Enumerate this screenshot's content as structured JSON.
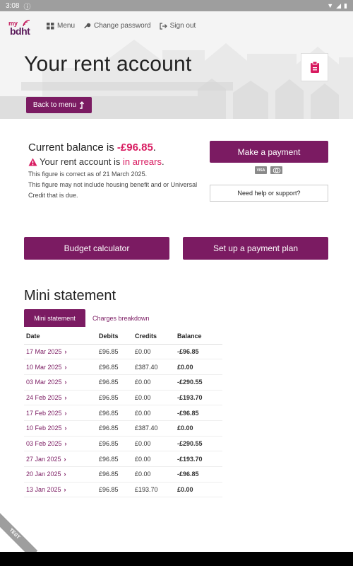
{
  "status_bar": {
    "time": "3:08",
    "info_icon": "info-icon",
    "wifi_icon": "wifi-icon",
    "signal_icon": "signal-icon",
    "battery_icon": "battery-icon"
  },
  "brand": {
    "logo_top": "my",
    "logo_main": "bdht",
    "accent": "#7b1b62",
    "highlight": "#d81b60"
  },
  "nav": {
    "menu": "Menu",
    "change_password": "Change password",
    "sign_out": "Sign out"
  },
  "header": {
    "title": "Your rent account",
    "back_label": "Back to menu"
  },
  "balance": {
    "prefix": "Current balance is ",
    "amount": "-£96.85",
    "suffix": ".",
    "arrears_prefix": "Your rent account is ",
    "arrears_word": "in arrears",
    "arrears_suffix": ".",
    "note_1": "This figure is correct as of 21 March 2025.",
    "note_2": "This figure may not include housing benefit and or Universal Credit that is due."
  },
  "actions": {
    "make_payment": "Make a payment",
    "card_visa": "VISA",
    "card_mc": "MC",
    "help": "Need help or support?",
    "budget": "Budget calculator",
    "payment_plan": "Set up a payment plan"
  },
  "mini_statement": {
    "title": "Mini statement",
    "tabs": [
      "Mini statement",
      "Charges breakdown"
    ],
    "headers": [
      "Date",
      "Debits",
      "Credits",
      "Balance"
    ],
    "rows": [
      {
        "date": "17 Mar 2025",
        "debit": "£96.85",
        "credit": "£0.00",
        "balance": "-£96.85"
      },
      {
        "date": "10 Mar 2025",
        "debit": "£96.85",
        "credit": "£387.40",
        "balance": "£0.00"
      },
      {
        "date": "03 Mar 2025",
        "debit": "£96.85",
        "credit": "£0.00",
        "balance": "-£290.55"
      },
      {
        "date": "24 Feb 2025",
        "debit": "£96.85",
        "credit": "£0.00",
        "balance": "-£193.70"
      },
      {
        "date": "17 Feb 2025",
        "debit": "£96.85",
        "credit": "£0.00",
        "balance": "-£96.85"
      },
      {
        "date": "10 Feb 2025",
        "debit": "£96.85",
        "credit": "£387.40",
        "balance": "£0.00"
      },
      {
        "date": "03 Feb 2025",
        "debit": "£96.85",
        "credit": "£0.00",
        "balance": "-£290.55"
      },
      {
        "date": "27 Jan 2025",
        "debit": "£96.85",
        "credit": "£0.00",
        "balance": "-£193.70"
      },
      {
        "date": "20 Jan 2025",
        "debit": "£96.85",
        "credit": "£0.00",
        "balance": "-£96.85"
      },
      {
        "date": "13 Jan 2025",
        "debit": "£96.85",
        "credit": "£193.70",
        "balance": "£0.00"
      }
    ]
  },
  "ribbon": "TEST"
}
